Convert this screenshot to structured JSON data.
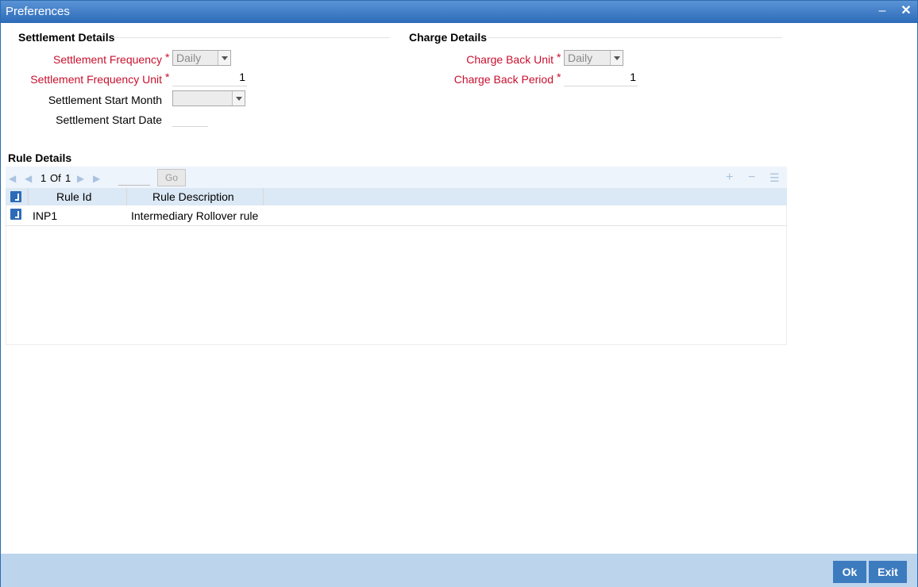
{
  "window": {
    "title": "Preferences",
    "minimize_icon": "minimize-icon",
    "close_icon": "close-icon"
  },
  "settlement": {
    "heading": "Settlement Details",
    "frequency_label": "Settlement Frequency",
    "frequency_value": "Daily",
    "frequency_unit_label": "Settlement Frequency Unit",
    "frequency_unit_value": "1",
    "start_month_label": "Settlement Start Month",
    "start_month_value": "",
    "start_date_label": "Settlement Start Date",
    "start_date_value": ""
  },
  "charge": {
    "heading": "Charge Details",
    "back_unit_label": "Charge Back Unit",
    "back_unit_value": "Daily",
    "back_period_label": "Charge Back Period",
    "back_period_value": "1"
  },
  "required_marker": "*",
  "rules": {
    "heading": "Rule Details",
    "pager": {
      "current": "1",
      "of_label": "Of",
      "total": "1",
      "go_label": "Go"
    },
    "columns": [
      "Rule Id",
      "Rule Description"
    ],
    "rows": [
      {
        "rule_id": "INP1",
        "description": "Intermediary Rollover rule"
      }
    ]
  },
  "footer": {
    "ok_label": "Ok",
    "exit_label": "Exit"
  },
  "colors": {
    "titlebar": "#2d6bb8",
    "required": "#c8102e",
    "footer": "#bcd4ec",
    "button": "#3d7bbf"
  }
}
